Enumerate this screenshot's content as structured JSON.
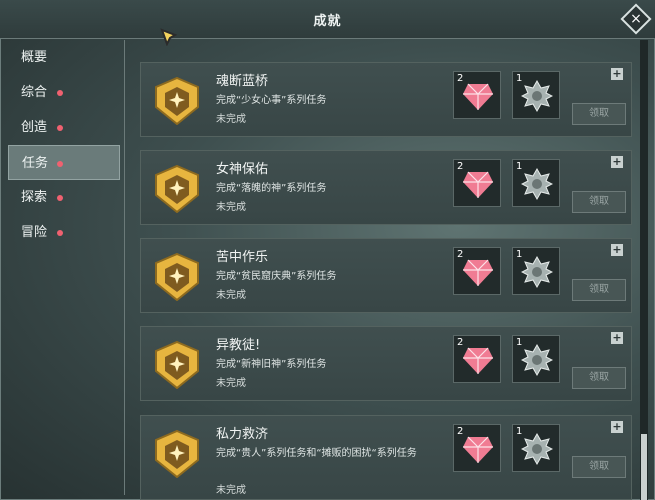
{
  "window": {
    "title": "成就"
  },
  "sidebar": {
    "items": [
      {
        "label": "概要",
        "dot": false,
        "active": false
      },
      {
        "label": "综合",
        "dot": true,
        "active": false
      },
      {
        "label": "创造",
        "dot": true,
        "active": false
      },
      {
        "label": "任务",
        "dot": true,
        "active": true
      },
      {
        "label": "探索",
        "dot": true,
        "active": false
      },
      {
        "label": "冒险",
        "dot": true,
        "active": false
      }
    ]
  },
  "achievements": [
    {
      "title": "魂断蓝桥",
      "desc": "完成“少女心事”系列任务",
      "status": "未完成",
      "reward1_count": "2",
      "reward2_count": "1",
      "claim_label": "领取"
    },
    {
      "title": "女神保佑",
      "desc": "完成“落魄的神”系列任务",
      "status": "未完成",
      "reward1_count": "2",
      "reward2_count": "1",
      "claim_label": "领取"
    },
    {
      "title": "苦中作乐",
      "desc": "完成“贫民窟庆典”系列任务",
      "status": "未完成",
      "reward1_count": "2",
      "reward2_count": "1",
      "claim_label": "领取"
    },
    {
      "title": "异教徒!",
      "desc": "完成“新神旧神”系列任务",
      "status": "未完成",
      "reward1_count": "2",
      "reward2_count": "1",
      "claim_label": "领取"
    },
    {
      "title": "私力救济",
      "desc": "完成“贵人”系列任务和“摊贩的困扰“系列任务",
      "status": "未完成",
      "reward1_count": "2",
      "reward2_count": "1",
      "claim_label": "领取"
    }
  ],
  "colors": {
    "accent_dot": "#f06170",
    "gem": "#f07c93",
    "badge_gold": "#e7b53f"
  },
  "icons": {
    "close": "close-icon",
    "expand": "plus-icon",
    "reward1": "gem-icon",
    "reward2": "star-medal-icon",
    "badge": "shield-badge-icon"
  }
}
